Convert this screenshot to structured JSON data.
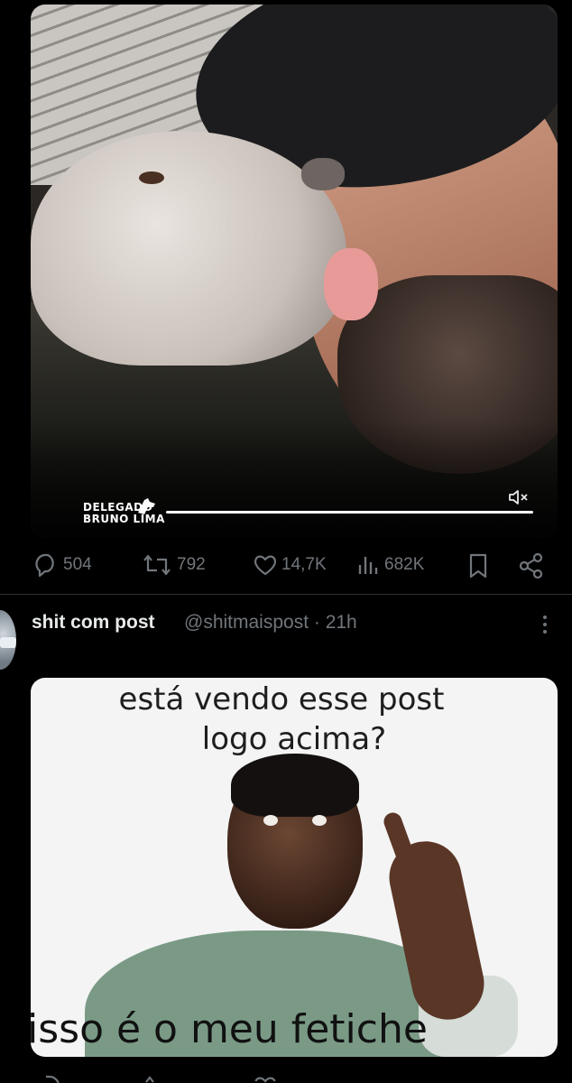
{
  "post1": {
    "video_watermark": [
      "DELEGADO",
      "BRUNO LIMA"
    ],
    "stats": {
      "replies": "504",
      "reposts": "792",
      "likes": "14,7K",
      "views": "682K"
    }
  },
  "post2": {
    "display_name": "shit com post",
    "handle_time": "@shitmaispost · 21h",
    "meme": {
      "top_line_1": "está vendo esse post",
      "top_line_2": "logo acima?",
      "bottom_text": "isso é o meu fetiche"
    }
  },
  "icons": [
    "reply-icon",
    "repost-icon",
    "like-icon",
    "views-icon",
    "bookmark-icon",
    "share-icon",
    "mute-icon",
    "more-icon"
  ],
  "colors": {
    "background": "#000000",
    "muted_text": "#71767b",
    "primary_text": "#e7e9ea"
  }
}
